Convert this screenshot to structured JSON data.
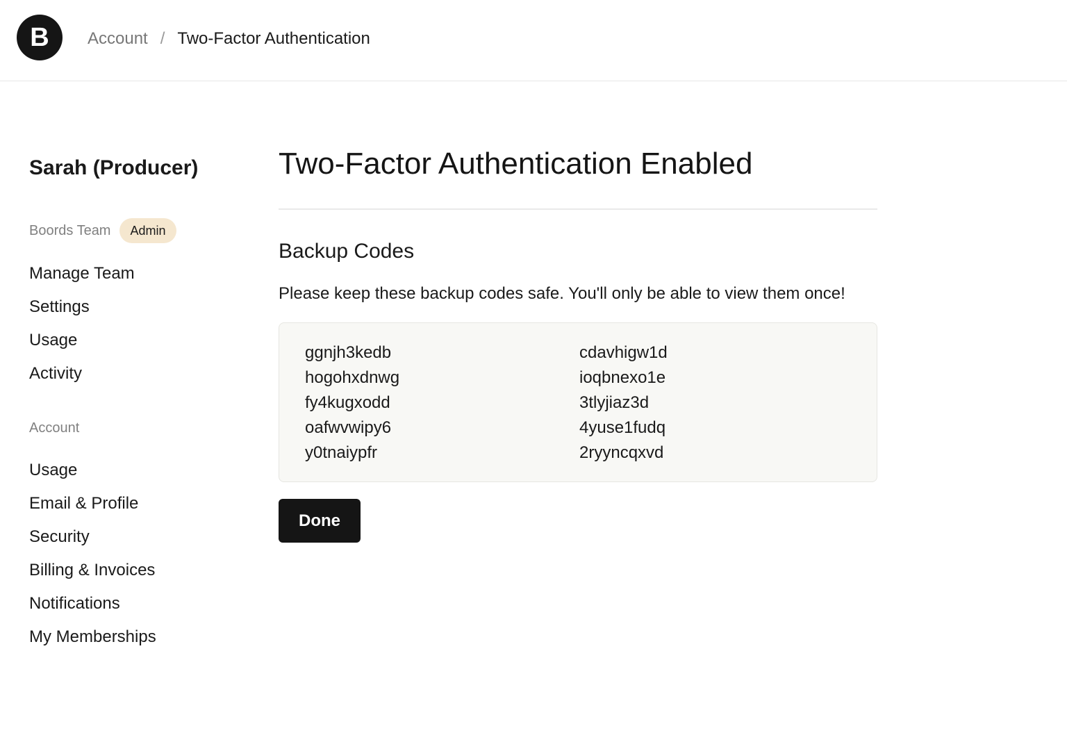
{
  "header": {
    "logo_letter": "B",
    "breadcrumb": {
      "parent": "Account",
      "separator": "/",
      "current": "Two-Factor Authentication"
    }
  },
  "sidebar": {
    "user_name": "Sarah (Producer)",
    "team": {
      "label": "Boords Team",
      "badge": "Admin",
      "items": [
        "Manage Team",
        "Settings",
        "Usage",
        "Activity"
      ]
    },
    "account": {
      "label": "Account",
      "items": [
        "Usage",
        "Email & Profile",
        "Security",
        "Billing & Invoices",
        "Notifications",
        "My Memberships"
      ]
    }
  },
  "main": {
    "title": "Two-Factor Authentication Enabled",
    "section_title": "Backup Codes",
    "instructions": "Please keep these backup codes safe. You'll only be able to view them once!",
    "codes": [
      "ggnjh3kedb",
      "cdavhigw1d",
      "hogohxdnwg",
      "ioqbnexo1e",
      "fy4kugxodd",
      "3tlyjiaz3d",
      "oafwvwipy6",
      "4yuse1fudq",
      "y0tnaiypfr",
      "2ryyncqxvd"
    ],
    "done_label": "Done"
  },
  "colors": {
    "logo_bg": "#151515",
    "badge_bg": "#f5e7cf",
    "codes_bg": "#f8f8f5",
    "button_bg": "#151515"
  }
}
